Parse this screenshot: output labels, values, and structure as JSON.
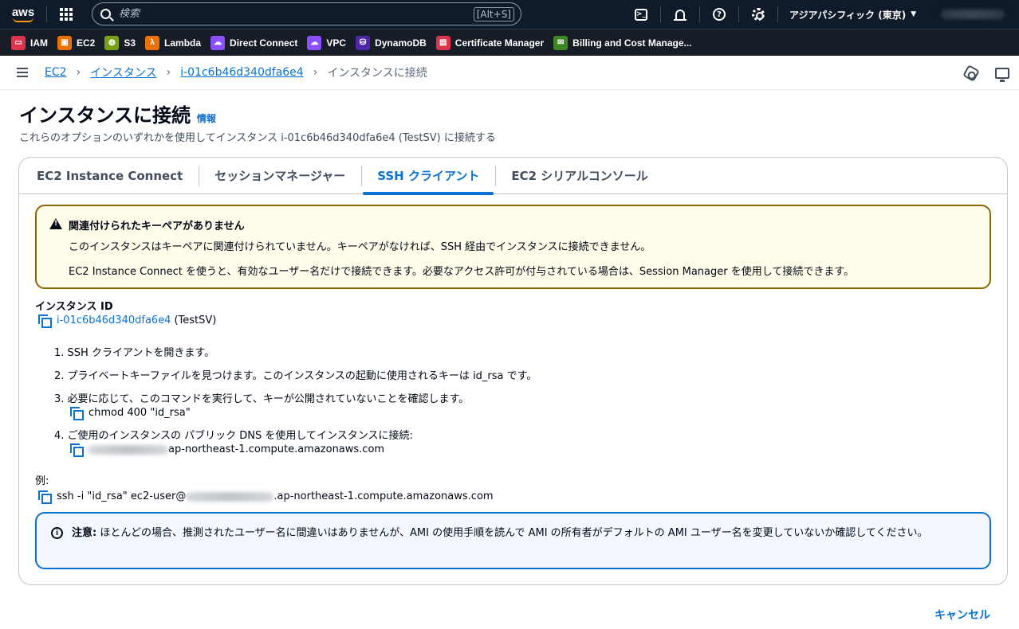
{
  "topbar": {
    "logo": "aws",
    "search_placeholder": "検索",
    "search_shortcut": "[Alt+S]",
    "region": "アジアパシフィック (東京)"
  },
  "favorites": [
    {
      "label": "IAM",
      "color": "#dd344c",
      "icon": "iam-icon"
    },
    {
      "label": "EC2",
      "color": "#ed7100",
      "icon": "ec2-icon"
    },
    {
      "label": "S3",
      "color": "#7aa116",
      "icon": "s3-icon"
    },
    {
      "label": "Lambda",
      "color": "#ed7100",
      "icon": "lambda-icon"
    },
    {
      "label": "Direct Connect",
      "color": "#8c4fff",
      "icon": "direct-connect-icon"
    },
    {
      "label": "VPC",
      "color": "#8c4fff",
      "icon": "vpc-icon"
    },
    {
      "label": "DynamoDB",
      "color": "#4d27aa",
      "icon": "dynamodb-icon"
    },
    {
      "label": "Certificate Manager",
      "color": "#dd344c",
      "icon": "certificate-manager-icon"
    },
    {
      "label": "Billing and Cost Manage...",
      "color": "#3f8624",
      "icon": "billing-icon"
    }
  ],
  "breadcrumb": {
    "items": [
      "EC2",
      "インスタンス",
      "i-01c6b46d340dfa6e4"
    ],
    "current": "インスタンスに接続"
  },
  "header": {
    "title": "インスタンスに接続",
    "info": "情報",
    "description": "これらのオプションのいずれかを使用してインスタンス i-01c6b46d340dfa6e4 (TestSV) に接続する"
  },
  "tabs": [
    {
      "label": "EC2 Instance Connect"
    },
    {
      "label": "セッションマネージャー"
    },
    {
      "label": "SSH クライアント",
      "active": true
    },
    {
      "label": "EC2 シリアルコンソール"
    }
  ],
  "warning": {
    "title": "関連付けられたキーペアがありません",
    "line1": "このインスタンスはキーペアに関連付けられていません。キーペアがなければ、SSH 経由でインスタンスに接続できません。",
    "line2": "EC2 Instance Connect を使うと、有効なユーザー名だけで接続できます。必要なアクセス許可が付与されている場合は、Session Manager を使用して接続できます。"
  },
  "instance": {
    "label": "インスタンス ID",
    "id": "i-01c6b46d340dfa6e4",
    "name": "(TestSV)"
  },
  "steps": {
    "s1": "1. SSH クライアントを開きます。",
    "s2": "2. プライベートキーファイルを見つけます。このインスタンスの起動に使用されるキーは id_rsa です。",
    "s3": "3. 必要に応じて、このコマンドを実行して、キーが公開されていないことを確認します。",
    "s3_cmd": "chmod 400 \"id_rsa\"",
    "s4": "4. ご使用のインスタンスの パブリック DNS を使用してインスタンスに接続:",
    "s4_dns_suffix": "ap-northeast-1.compute.amazonaws.com"
  },
  "example": {
    "label": "例:",
    "prefix": "ssh -i \"id_rsa\" ec2-user@",
    "suffix": ".ap-northeast-1.compute.amazonaws.com"
  },
  "note": {
    "bold": "注意:",
    "text": " ほとんどの場合、推測されたユーザー名に間違いはありませんが、AMI の使用手順を読んで AMI の所有者がデフォルトの AMI ユーザー名を変更していないか確認してください。"
  },
  "footer": {
    "cancel": "キャンセル"
  }
}
